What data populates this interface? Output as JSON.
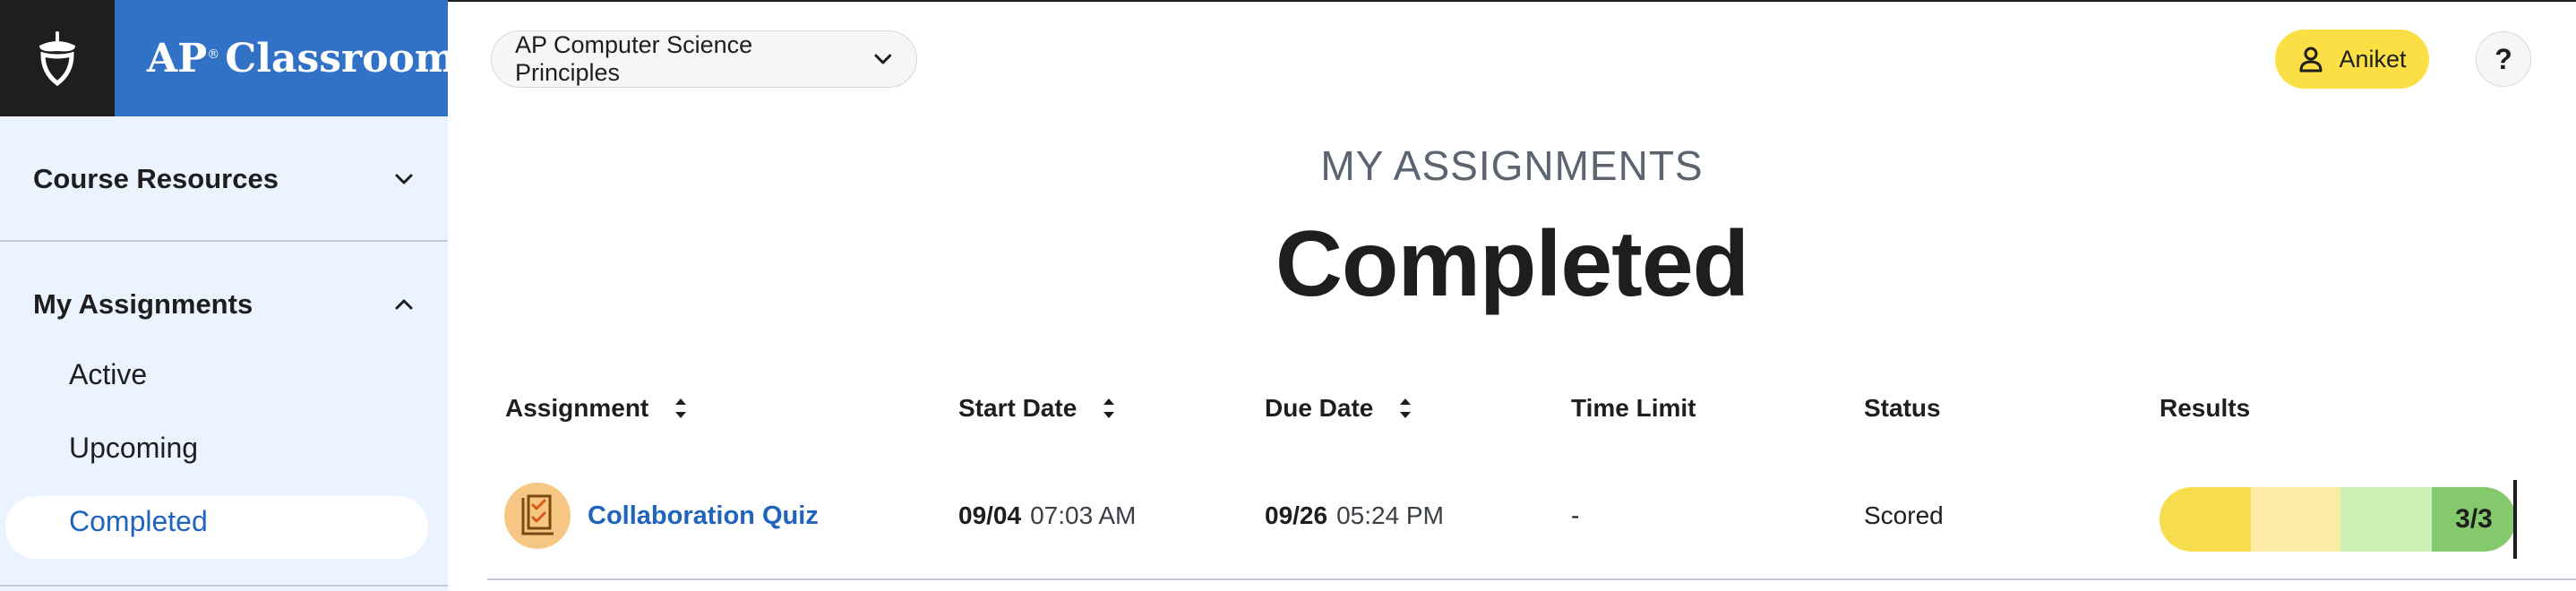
{
  "brand": {
    "prefix": "AP",
    "registered": "®",
    "name": "Classroom"
  },
  "sidebar": {
    "sections": [
      {
        "label": "Course Resources",
        "expanded": false
      },
      {
        "label": "My Assignments",
        "expanded": true
      }
    ],
    "assignment_items": [
      {
        "label": "Active"
      },
      {
        "label": "Upcoming"
      },
      {
        "label": "Completed",
        "selected": true
      }
    ]
  },
  "header": {
    "course": "AP Computer Science Principles",
    "user": "Aniket",
    "help": "?"
  },
  "page": {
    "eyebrow": "MY ASSIGNMENTS",
    "title": "Completed"
  },
  "table": {
    "columns": [
      "Assignment",
      "Start Date",
      "Due Date",
      "Time Limit",
      "Status",
      "Results"
    ],
    "rows": [
      {
        "assignment": "Collaboration Quiz",
        "start_date": "09/04",
        "start_time": "07:03 AM",
        "due_date": "09/26",
        "due_time": "05:24 PM",
        "time_limit": "-",
        "status": "Scored",
        "result": "3/3"
      }
    ]
  },
  "colors": {
    "brand_blue": "#3172c7",
    "sidebar_bg": "#eaf3fe",
    "link_blue": "#1f63bd",
    "user_yellow": "#fcdf44",
    "result_segments": [
      "#f7dc4b",
      "#fbeba4",
      "#cdf0b5",
      "#84c96b"
    ]
  }
}
